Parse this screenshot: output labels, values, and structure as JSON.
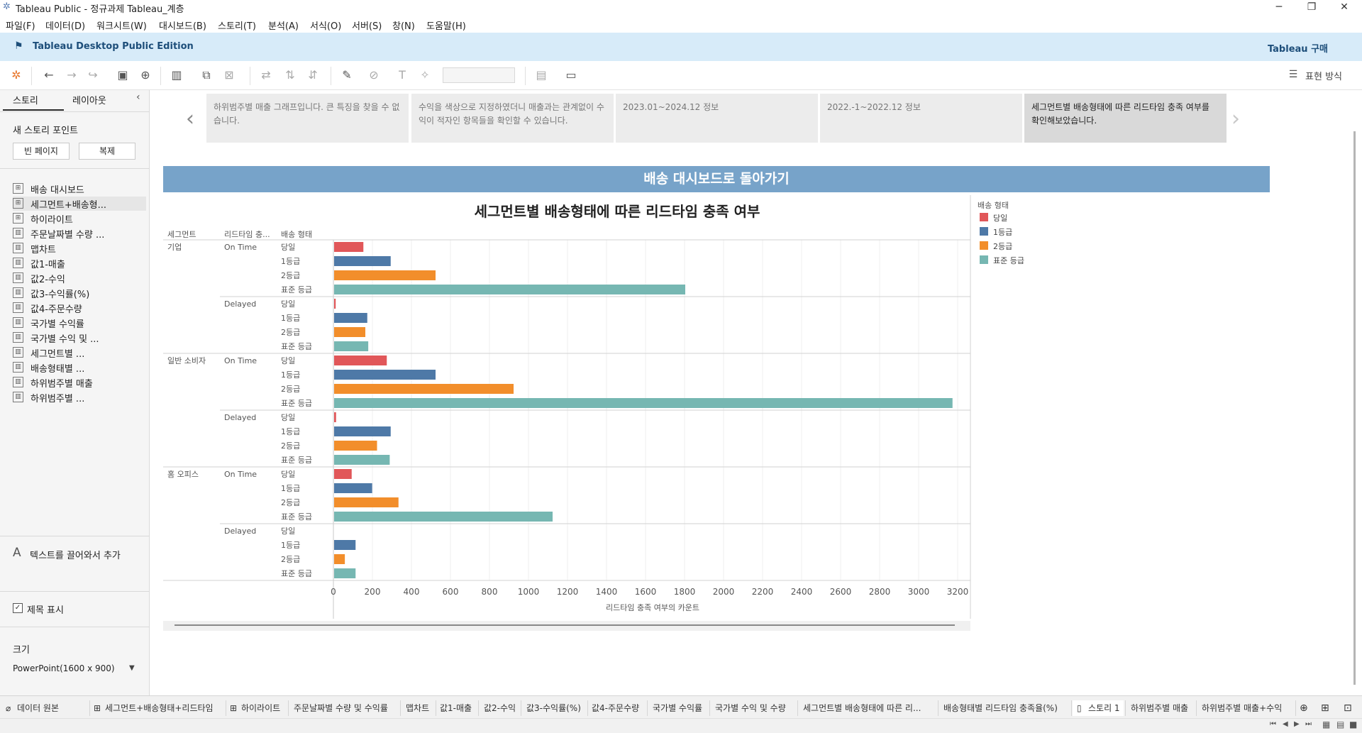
{
  "window": {
    "title": "Tableau Public - 정규과제 Tableau_계층",
    "minimize": "─",
    "maximize": "❐",
    "close": "✕"
  },
  "menu": [
    "파일(F)",
    "데이터(D)",
    "워크시트(W)",
    "대시보드(B)",
    "스토리(T)",
    "분석(A)",
    "서식(O)",
    "서버(S)",
    "창(N)",
    "도움말(H)"
  ],
  "banner": {
    "edition": "Tableau Desktop Public Edition",
    "buy": "Tableau 구매"
  },
  "toolbar": {
    "present_label": "표현 방식"
  },
  "left_panel": {
    "tab_story": "스토리",
    "tab_layout": "레이아웃",
    "new_story_point": "새 스토리 포인트",
    "blank_page": "빈 페이지",
    "duplicate": "복제",
    "sheets": [
      "배송 대시보드",
      "세그먼트+배송형...",
      "하이라이트",
      "주문날짜별 수량 ...",
      "맵차트",
      "값1-매출",
      "값2-수익",
      "값3-수익률(%)",
      "값4-주문수량",
      "국가별 수익률",
      "국가별 수익 및 ...",
      "세그먼트별 ...",
      "배송형태별 ...",
      "하위범주별 매출",
      "하위범주별 ..."
    ],
    "drag_text": "텍스트를 끌어와서 추가",
    "show_title": "제목 표시",
    "size_label": "크기",
    "size_value": "PowerPoint(1600 x 900)"
  },
  "story_points": [
    "하위범주별 매출 그래프입니다. 큰 특징을 찾을 수 없습니다.",
    "수익을 색상으로 지정하였더니 매출과는 관계없이 수익이 적자인 항목들을 확인할 수 있습니다.",
    "2023.01~2024.12 정보",
    "2022.-1~2022.12 정보",
    "세그먼트별 배송형태에 따른 리드타임 충족 여부를 확인해보았습니다."
  ],
  "dashboard": {
    "back_button": "배송 대시보드로 돌아가기"
  },
  "chart_data": {
    "type": "bar",
    "title": "세그먼트별 배송형태에 따른 리드타임 충족 여부",
    "headers": [
      "세그먼트",
      "리드타임 충...",
      "배송 형태"
    ],
    "xlabel": "리드타임 충족 여부의 카운트",
    "xlim": [
      0,
      3200
    ],
    "xticks": [
      0,
      200,
      400,
      600,
      800,
      1000,
      1200,
      1400,
      1600,
      1800,
      2000,
      2200,
      2400,
      2600,
      2800,
      3000,
      3200
    ],
    "legend_title": "배송 형태",
    "legend_position": "top-right",
    "series": [
      {
        "name": "당일",
        "color": "#e15759"
      },
      {
        "name": "1등급",
        "color": "#4e79a7"
      },
      {
        "name": "2등급",
        "color": "#f28e2b"
      },
      {
        "name": "표준 등급",
        "color": "#76b7b2"
      }
    ],
    "segments": [
      {
        "name": "기업",
        "groups": [
          {
            "leadtime": "On Time",
            "values": [
              150,
              290,
              520,
              1800
            ]
          },
          {
            "leadtime": "Delayed",
            "values": [
              8,
              170,
              160,
              175
            ]
          }
        ]
      },
      {
        "name": "일반 소비자",
        "groups": [
          {
            "leadtime": "On Time",
            "values": [
              270,
              520,
              920,
              3170
            ]
          },
          {
            "leadtime": "Delayed",
            "values": [
              10,
              290,
              220,
              285
            ]
          }
        ]
      },
      {
        "name": "홈 오피스",
        "groups": [
          {
            "leadtime": "On Time",
            "values": [
              90,
              195,
              330,
              1120
            ]
          },
          {
            "leadtime": "Delayed",
            "values": [
              0,
              110,
              55,
              110
            ]
          }
        ]
      }
    ]
  },
  "bottom_tabs": [
    "데이터 원본",
    "세그먼트+배송형태+리드타임",
    "하이라이트",
    "주문날짜별 수량 및 수익률",
    "맵차트",
    "값1-매출",
    "값2-수익",
    "값3-수익률(%)",
    "값4-주문수량",
    "국가별 수익률",
    "국가별 수익 및 수량",
    "세그먼트별 배송형태에 따른 리...",
    "배송형태별 리드타임 충족율(%)",
    "스토리 1",
    "하위범주별 매출",
    "하위범주별 매출+수익"
  ]
}
